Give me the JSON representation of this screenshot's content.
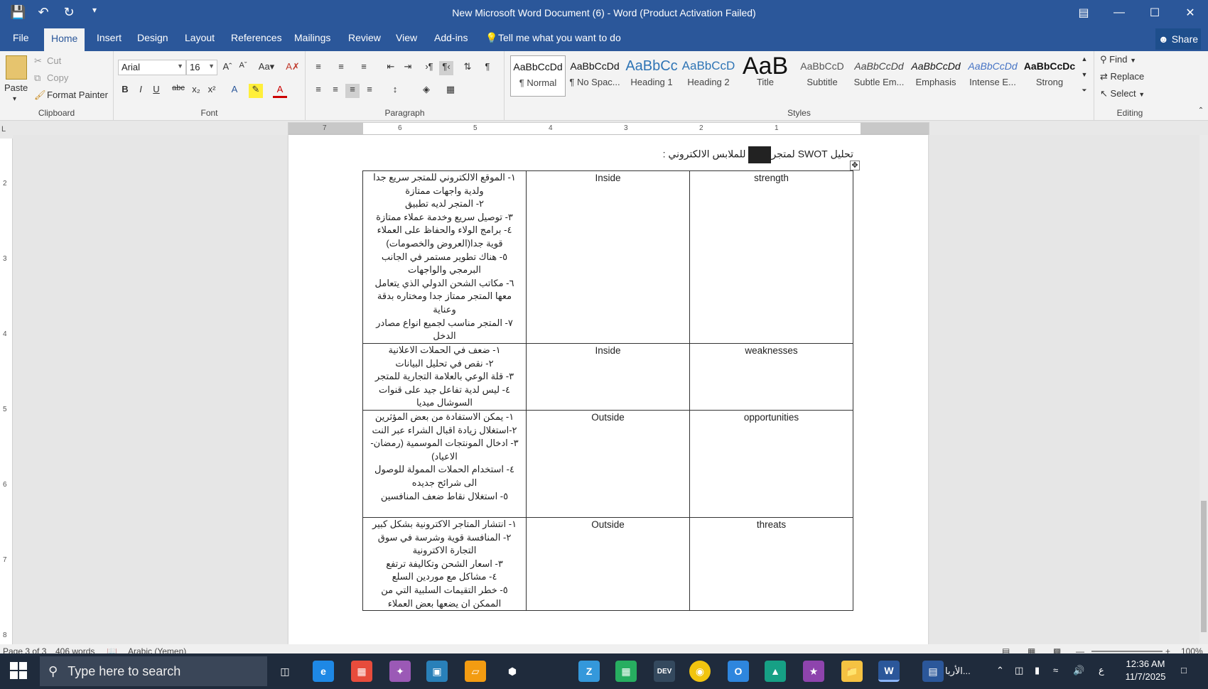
{
  "window": {
    "title": "New Microsoft Word Document (6) - Word (Product Activation Failed)",
    "qat": [
      "save-icon",
      "undo-icon",
      "redo-icon",
      "customize-icon"
    ]
  },
  "tabs": {
    "file": "File",
    "home": "Home",
    "insert": "Insert",
    "design": "Design",
    "layout": "Layout",
    "references": "References",
    "mailings": "Mailings",
    "review": "Review",
    "view": "View",
    "addins": "Add-ins",
    "tell_me": "Tell me what you want to do",
    "share": "Share"
  },
  "clipboard": {
    "paste": "Paste",
    "cut": "Cut",
    "copy": "Copy",
    "format_painter": "Format Painter",
    "label": "Clipboard"
  },
  "font": {
    "name": "Arial",
    "size": "16",
    "label": "Font"
  },
  "paragraph": {
    "label": "Paragraph"
  },
  "styles": {
    "label": "Styles",
    "items": [
      {
        "sample": "AaBbCcDd",
        "name": "¶ Normal"
      },
      {
        "sample": "AaBbCcDd",
        "name": "¶ No Spac..."
      },
      {
        "sample": "AaBbCc",
        "name": "Heading 1"
      },
      {
        "sample": "AaBbCcD",
        "name": "Heading 2"
      },
      {
        "sample": "AaB",
        "name": "Title"
      },
      {
        "sample": "AaBbCcD",
        "name": "Subtitle"
      },
      {
        "sample": "AaBbCcDd",
        "name": "Subtle Em..."
      },
      {
        "sample": "AaBbCcDd",
        "name": "Emphasis"
      },
      {
        "sample": "AaBbCcDd",
        "name": "Intense E..."
      },
      {
        "sample": "AaBbCcDc",
        "name": "Strong"
      }
    ]
  },
  "editing": {
    "find": "Find",
    "replace": "Replace",
    "select": "Select",
    "label": "Editing"
  },
  "ruler": {
    "ticks": [
      "7",
      "6",
      "5",
      "4",
      "3",
      "2",
      "1"
    ],
    "vticks": [
      "2",
      "3",
      "4",
      "5",
      "6",
      "7",
      "8"
    ]
  },
  "document": {
    "heading_left": "تحليل SWOT لمتجر",
    "heading_right": "للملابس الالكتروني :",
    "rows": [
      {
        "factor": "strength",
        "scope": "Inside",
        "lines": [
          "١- الموقع الالكتروني للمتجر سريع جدا ولدية واجهات ممتازة",
          "٢- المتجر لديه تطبيق",
          "٣- توصيل سريع وخدمة عملاء ممتازة",
          "٤- برامج الولاء والحفاظ على العملاء قوية جدا(العروض والخصومات)",
          "٥- هناك تطوير مستمر في الجانب البرمجي والواجهات",
          "٦- مكاتب الشحن الدولي الذي يتعامل معها المتجر ممتاز جدا ومختاره بدقة وعناية",
          "٧- المتجر مناسب لجميع انواع مصادر الدخل"
        ]
      },
      {
        "factor": "weaknesses",
        "scope": "Inside",
        "lines": [
          "١- ضعف في الحملات الاعلانية",
          "٢- نقص في تحليل البيانات",
          "٣- قلة الوعي بالعلامة التجارية للمتجر",
          "٤- ليس لدية تفاعل جيد على قنوات السوشال ميديا"
        ]
      },
      {
        "factor": "opportunities",
        "scope": "Outside",
        "lines": [
          "١- يمكن الاستفادة من بعض المؤثرين",
          "٢-استغلال زيادة اقبال الشراء عبر النت",
          "٣- ادخال المونتجات الموسمية (رمضان- الاعياد)",
          "٤- استخدام الحملات الممولة للوصول الى شرائح جديده",
          "٥- استغلال نقاط ضعف المنافسين"
        ]
      },
      {
        "factor": "threats",
        "scope": "Outside",
        "lines": [
          "١- انتشار المتاجر الاكترونية بشكل كبير",
          "٢- المنافسة قوية وشرسة في سوق التجارة الاكترونية",
          "٣- اسعار الشحن وتكاليفة ترتفع",
          "٤- مشاكل مع موردين السلع",
          "٥- خطر التقيمات السلبية التي من الممكن ان يضعها بعض العملاء"
        ]
      }
    ]
  },
  "status": {
    "page": "Page 3 of 3",
    "words": "406 words",
    "language": "Arabic (Yemen)",
    "zoom": "100%"
  },
  "taskbar": {
    "search_placeholder": "Type here to search",
    "lang": "ع",
    "time": "12:36 AM",
    "date": "11/7/2025",
    "app_label": "الأربا..."
  },
  "colors": {
    "word_blue": "#2b579a",
    "taskbar": "#1f2b3c"
  }
}
